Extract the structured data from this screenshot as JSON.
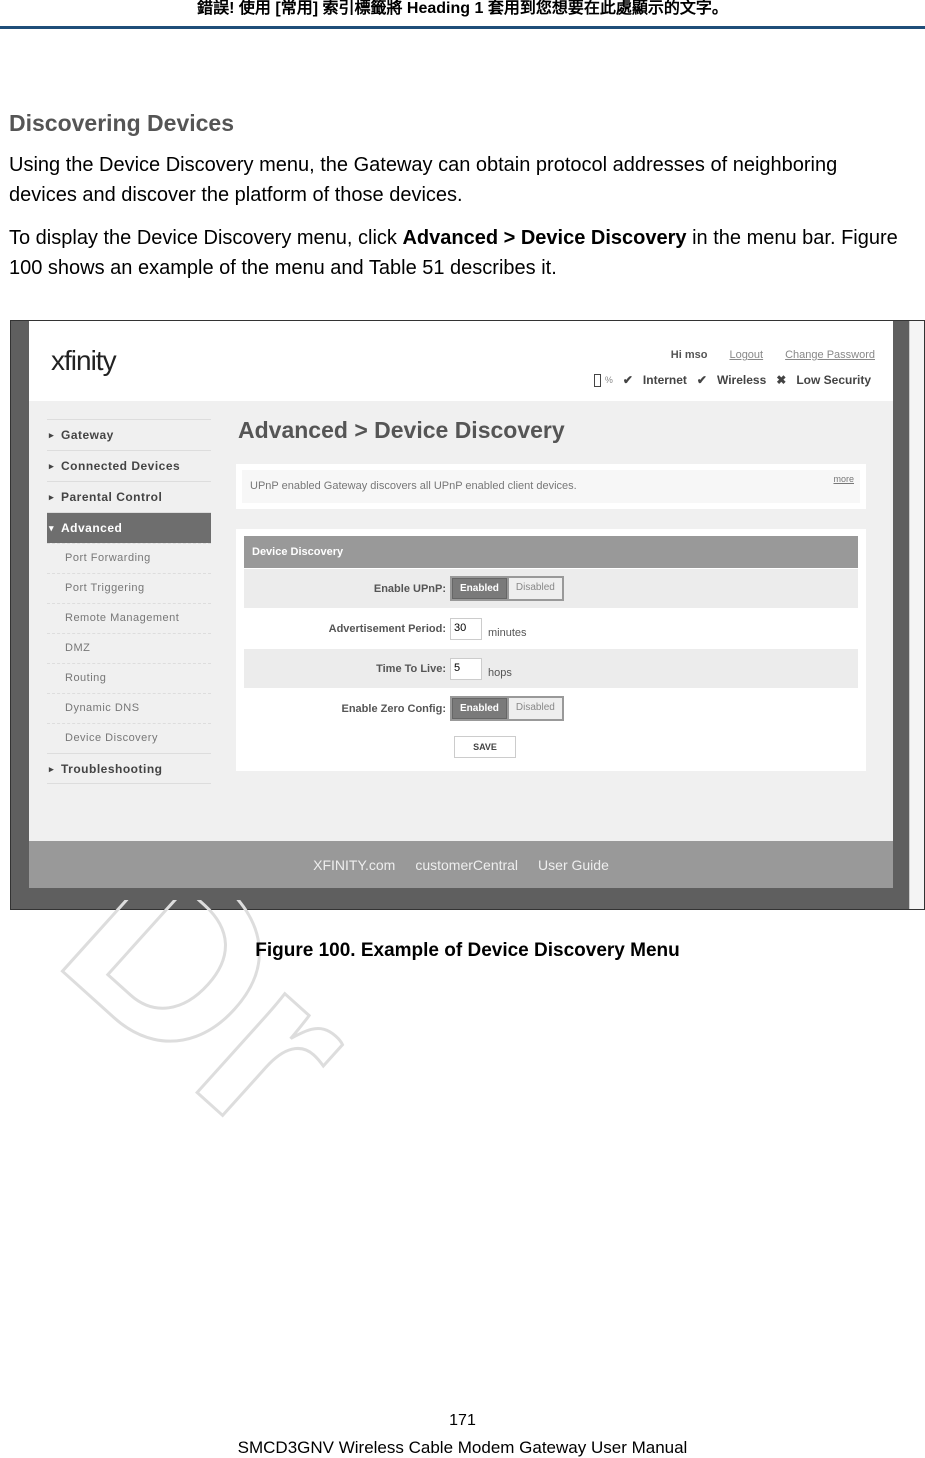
{
  "page_header": "錯誤! 使用 [常用] 索引標籤將 Heading 1 套用到您想要在此處顯示的文字。",
  "section_title": "Discovering Devices",
  "para1": "Using the Device Discovery menu, the Gateway can obtain protocol addresses of neighboring devices and discover the platform of those devices.",
  "para2": {
    "pre": "To display the Device Discovery menu, click ",
    "bold": "Advanced > Device Discovery",
    "post": " in the menu bar. Figure 100 shows an example of the menu and Table 51 describes it."
  },
  "screenshot": {
    "logo": "xfinity",
    "greeting": "Hi mso",
    "logout": "Logout",
    "change_password": "Change Password",
    "status": {
      "battery": "%",
      "internet": "Internet",
      "wireless": "Wireless",
      "security": "Low Security"
    },
    "nav": {
      "top": [
        "Gateway",
        "Connected Devices",
        "Parental Control"
      ],
      "active": "Advanced",
      "sub": [
        "Port Forwarding",
        "Port Triggering",
        "Remote Management",
        "DMZ",
        "Routing",
        "Dynamic DNS",
        "Device Discovery"
      ],
      "bottom": "Troubleshooting"
    },
    "title": "Advanced > Device Discovery",
    "info": "UPnP enabled Gateway discovers all UPnP enabled client devices.",
    "more": "more",
    "panel_title": "Device Discovery",
    "enable_upnp": {
      "label": "Enable UPnP:",
      "on": "Enabled",
      "off": "Disabled",
      "selected": "Enabled"
    },
    "adv_period": {
      "label": "Advertisement Period:",
      "value": "30",
      "unit": "minutes"
    },
    "ttl": {
      "label": "Time To Live:",
      "value": "5",
      "unit": "hops"
    },
    "zero_config": {
      "label": "Enable Zero Config:",
      "on": "Enabled",
      "off": "Disabled",
      "selected": "Enabled"
    },
    "save": "SAVE",
    "footer": [
      "XFINITY.com",
      "customerCentral",
      "User Guide"
    ]
  },
  "caption": "Figure 100. Example of Device Discovery Menu",
  "watermark": "Draft",
  "page_number": "171",
  "manual_title": "SMCD3GNV Wireless Cable Modem Gateway User Manual"
}
